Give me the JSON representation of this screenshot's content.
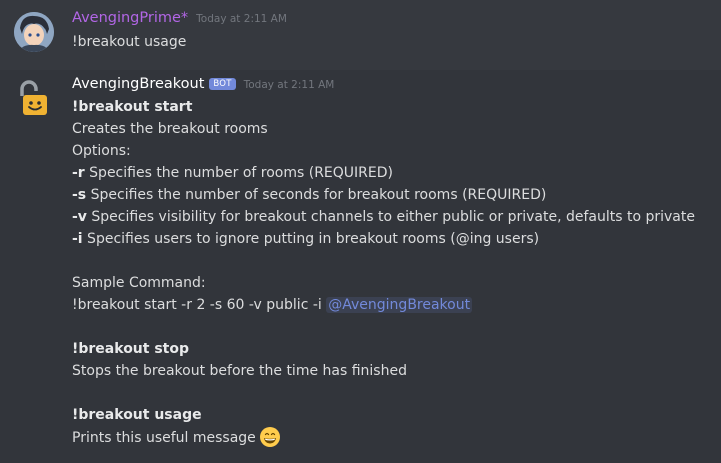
{
  "messages": [
    {
      "author": "AvengingPrime*",
      "timestamp": "Today at 2:11 AM",
      "text": "!breakout usage"
    },
    {
      "author": "AvengingBreakout",
      "bot_tag": "BOT",
      "timestamp": "Today at 2:11 AM",
      "start_heading": "!breakout start",
      "start_desc": "Creates the breakout rooms",
      "options_label": "Options:",
      "options": [
        {
          "flag": "-r",
          "text": " Specifies the number of rooms (REQUIRED)"
        },
        {
          "flag": "-s",
          "text": " Specifies the number of seconds for breakout rooms (REQUIRED)"
        },
        {
          "flag": "-v",
          "text": " Specifies visibility for breakout channels to either public or private, defaults to private"
        },
        {
          "flag": "-i",
          "text": " Specifies users to ignore putting in breakout rooms (@ing users)"
        }
      ],
      "sample_label": "Sample Command:",
      "sample_command": "!breakout start -r 2 -s 60 -v public -i ",
      "sample_mention": "@AvengingBreakout",
      "stop_heading": "!breakout stop",
      "stop_desc": "Stops the breakout before the time has finished",
      "usage_heading": "!breakout usage",
      "usage_desc": "Prints this useful message",
      "usage_emoji": "grinning-face-emoji"
    }
  ],
  "colors": {
    "background": "#36393f",
    "highlight_row": "#32353b",
    "user_name": "#b266e6",
    "bot_tag": "#7289da",
    "mention": "#7289da",
    "timestamp": "#72767d",
    "text": "#dcddde"
  }
}
